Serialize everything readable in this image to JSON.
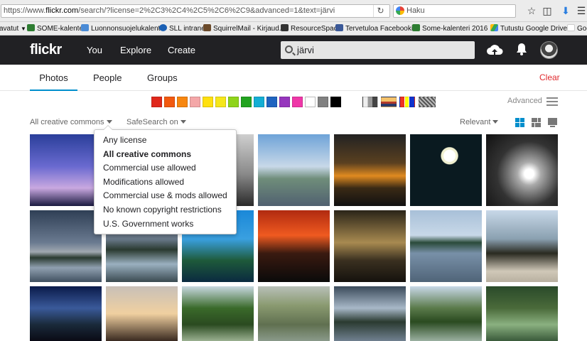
{
  "browser": {
    "url_prefix": "https://www.",
    "url_host": "flickr.com",
    "url_rest": "/search/?license=2%2C3%2C4%2C5%2C6%2C9&advanced=1&text=järvi",
    "search_placeholder": "Haku",
    "bookmarks": [
      {
        "label": "avatut",
        "icon": "folder-icon"
      },
      {
        "label": "SOME-kalenteri",
        "icon": "sheet-icon"
      },
      {
        "label": "Luonnonsuojelukalent...",
        "icon": "calendar-icon"
      },
      {
        "label": "SLL intranet",
        "icon": "globe-icon"
      },
      {
        "label": "SquirrelMail - Kirjaud...",
        "icon": "squirrel-icon"
      },
      {
        "label": "ResourceSpace",
        "icon": "resourcespace-icon"
      },
      {
        "label": "Tervetuloa Facebookii...",
        "icon": "facebook-icon"
      },
      {
        "label": "Some-kalenteri 2016 ...",
        "icon": "sheet-icon"
      },
      {
        "label": "Tutustu Google Drive...",
        "icon": "drive-icon"
      },
      {
        "label": "Goo",
        "icon": "google-icon"
      }
    ]
  },
  "header": {
    "logo": "flickr",
    "nav": [
      "You",
      "Explore",
      "Create"
    ],
    "search_value": "järvi"
  },
  "tabs": {
    "items": [
      "Photos",
      "People",
      "Groups"
    ],
    "active": "Photos",
    "clear_label": "Clear"
  },
  "colors": {
    "swatches": [
      "#e0281c",
      "#f2590f",
      "#f7860f",
      "#f4a7a8",
      "#ffe00f",
      "#f6e71a",
      "#8fd41a",
      "#22a31f",
      "#13aed4",
      "#1f64c0",
      "#9636bd",
      "#ef37a8",
      "#ffffff",
      "#808080",
      "#000000"
    ],
    "advanced_label": "Advanced"
  },
  "filters": {
    "license_label": "All creative commons",
    "safesearch_label": "SafeSearch on",
    "sort_label": "Relevant"
  },
  "license_menu": {
    "options": [
      "Any license",
      "All creative commons",
      "Commercial use allowed",
      "Modifications allowed",
      "Commercial use & mods allowed",
      "No known copyright restrictions",
      "U.S. Government works"
    ],
    "selected": "All creative commons"
  },
  "accent": "#008ecc",
  "clear_color": "#e0292e"
}
